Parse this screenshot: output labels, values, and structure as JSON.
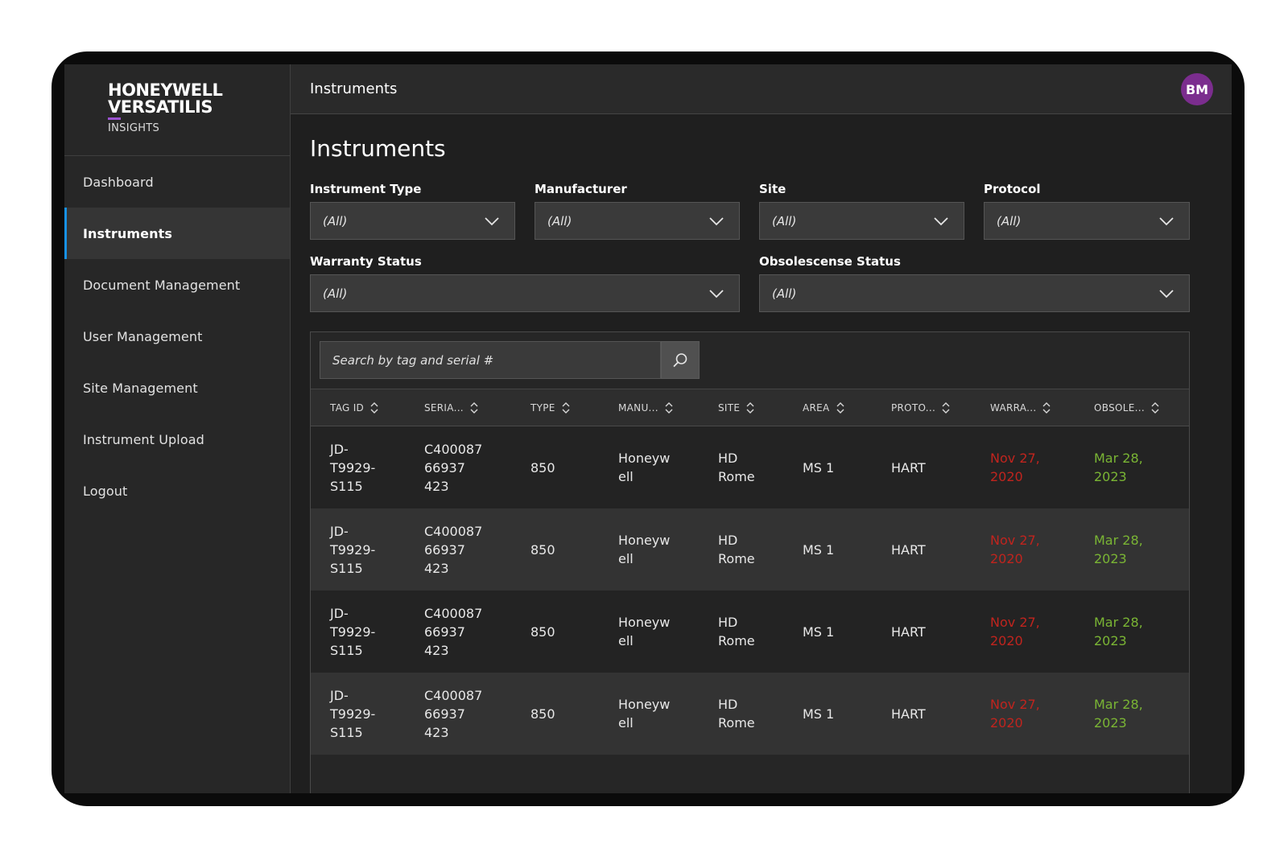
{
  "brand": {
    "line1": "HONEYWELL",
    "line2": "VERSATILIS",
    "sub": "INSIGHTS",
    "accent_color": "#9b52d1"
  },
  "sidebar": {
    "items": [
      {
        "label": "Dashboard",
        "active": false
      },
      {
        "label": "Instruments",
        "active": true
      },
      {
        "label": "Document Management",
        "active": false
      },
      {
        "label": "User Management",
        "active": false
      },
      {
        "label": "Site Management",
        "active": false
      },
      {
        "label": "Instrument Upload",
        "active": false
      },
      {
        "label": "Logout",
        "active": false
      }
    ],
    "active_indicator_color": "#1792e5"
  },
  "topbar": {
    "title": "Instruments",
    "avatar_initials": "BM",
    "avatar_color": "#7b2d8e"
  },
  "page": {
    "title": "Instruments"
  },
  "filters": [
    {
      "label": "Instrument Type",
      "value": "(All)"
    },
    {
      "label": "Manufacturer",
      "value": "(All)"
    },
    {
      "label": "Site",
      "value": "(All)"
    },
    {
      "label": "Protocol",
      "value": "(All)"
    },
    {
      "label": "Warranty Status",
      "value": "(All)"
    },
    {
      "label": "Obsolescense Status",
      "value": "(All)"
    }
  ],
  "search": {
    "placeholder": "Search by tag and serial #",
    "icon": "search-icon"
  },
  "table": {
    "columns": [
      "TAG ID",
      "SERIA...",
      "TYPE",
      "MANU...",
      "SITE",
      "AREA",
      "PROTO...",
      "WARRA...",
      "OBSOLE..."
    ],
    "rows": [
      {
        "tag_id": "JD-\nT9929-\nS115",
        "serial": "C400087\n66937\n423",
        "type": "850",
        "manufacturer": "Honeyw\nell",
        "site": "HD\nRome",
        "area": "MS 1",
        "protocol": "HART",
        "warranty": "Nov 27,\n2020",
        "obsolescence": "Mar 28,\n2023"
      },
      {
        "tag_id": "JD-\nT9929-\nS115",
        "serial": "C400087\n66937\n423",
        "type": "850",
        "manufacturer": "Honeyw\nell",
        "site": "HD\nRome",
        "area": "MS 1",
        "protocol": "HART",
        "warranty": "Nov 27,\n2020",
        "obsolescence": "Mar 28,\n2023"
      },
      {
        "tag_id": "JD-\nT9929-\nS115",
        "serial": "C400087\n66937\n423",
        "type": "850",
        "manufacturer": "Honeyw\nell",
        "site": "HD\nRome",
        "area": "MS 1",
        "protocol": "HART",
        "warranty": "Nov 27,\n2020",
        "obsolescence": "Mar 28,\n2023"
      },
      {
        "tag_id": "JD-\nT9929-\nS115",
        "serial": "C400087\n66937\n423",
        "type": "850",
        "manufacturer": "Honeyw\nell",
        "site": "HD\nRome",
        "area": "MS 1",
        "protocol": "HART",
        "warranty": "Nov 27,\n2020",
        "obsolescence": "Mar 28,\n2023"
      }
    ],
    "status_colors": {
      "expired": "#c0241e",
      "valid": "#7ab534"
    }
  }
}
